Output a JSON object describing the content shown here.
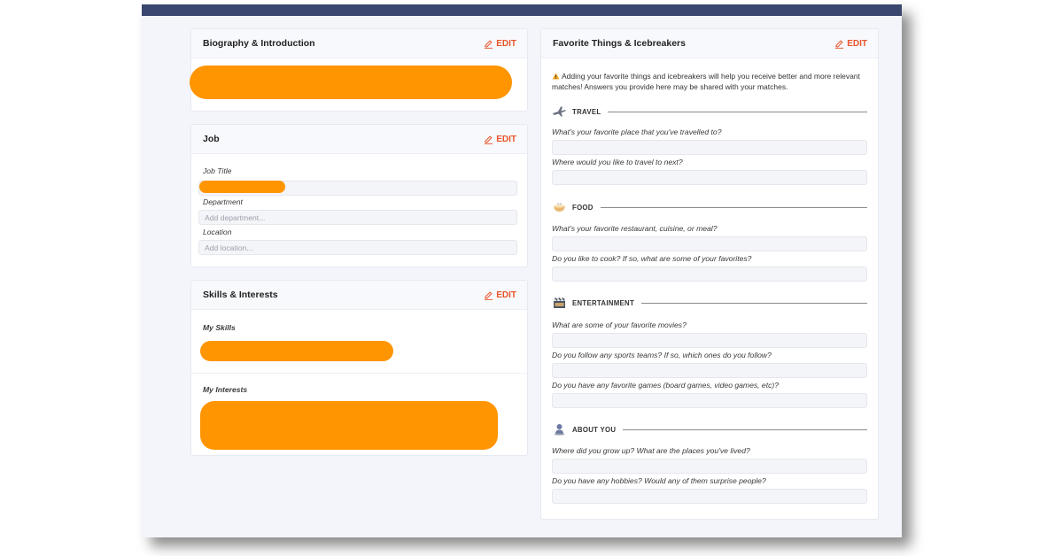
{
  "bio": {
    "title": "Biography & Introduction",
    "edit": "EDIT"
  },
  "job": {
    "title": "Job",
    "edit": "EDIT",
    "job_title_label": "Job Title",
    "department_label": "Department",
    "department_placeholder": "Add department...",
    "location_label": "Location",
    "location_placeholder": "Add location..."
  },
  "skills": {
    "title": "Skills & Interests",
    "edit": "EDIT",
    "my_skills": "My Skills",
    "my_interests": "My Interests"
  },
  "favorites": {
    "title": "Favorite Things & Icebreakers",
    "edit": "EDIT",
    "notice": "Adding your favorite things and icebreakers will help you receive better and more relevant matches! Answers you provide here may be shared with your matches.",
    "travel": {
      "name": "TRAVEL",
      "q1": "What's your favorite place that you've travelled to?",
      "q2": "Where would you like to travel to next?"
    },
    "food": {
      "name": "FOOD",
      "q1": "What's your favorite restaurant, cuisine, or meal?",
      "q2": "Do you like to cook? If so, what are some of your favorites?"
    },
    "entertainment": {
      "name": "ENTERTAINMENT",
      "q1": "What are some of your favorite movies?",
      "q2": "Do you follow any sports teams? If so, which ones do you follow?",
      "q3": "Do you have any favorite games (board games, video games, etc)?"
    },
    "about": {
      "name": "ABOUT YOU",
      "q1": "Where did you grow up? What are the places you've lived?",
      "q2": "Do you have any hobbies? Would any of them surprise people?"
    }
  },
  "colors": {
    "accent": "#e8542a",
    "redaction": "#ff9500",
    "topbar": "#3a466e"
  }
}
